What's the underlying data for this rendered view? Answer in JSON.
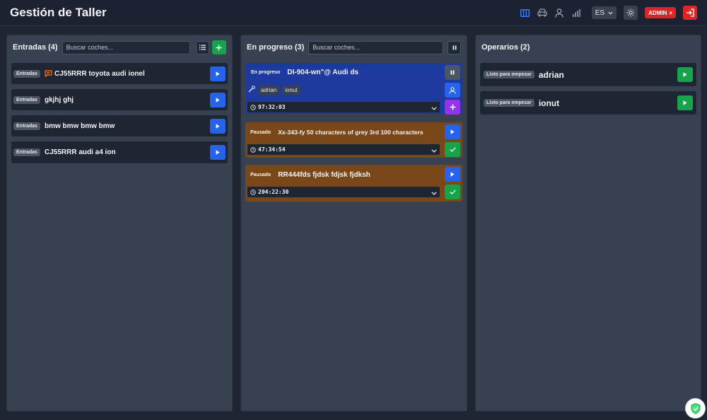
{
  "app": {
    "title": "Gestión de Taller"
  },
  "topbar": {
    "icons": [
      "board-icon",
      "car-icon",
      "user-icon",
      "bar-chart-icon"
    ],
    "language": "ES",
    "admin_label": "ADMIN",
    "admin_close": "×",
    "accent": "#2563eb",
    "danger": "#dc2626"
  },
  "entradas": {
    "title": "Entradas (4)",
    "search_placeholder": "Buscar coches...",
    "cards": [
      {
        "badge": "Entradas",
        "title": "CJ55RRR toyota audi ionel",
        "has_message": true
      },
      {
        "badge": "Entradas",
        "title": "gkjhj ghj",
        "has_message": false
      },
      {
        "badge": "Entradas",
        "title": "bmw bmw bmw bmw",
        "has_message": false
      },
      {
        "badge": "Entradas",
        "title": "CJ55RRR audi a4 ion",
        "has_message": false
      }
    ]
  },
  "progreso": {
    "title": "En progreso (3)",
    "search_placeholder": "Buscar coches...",
    "jobs": [
      {
        "status": "En progreso",
        "title": "DI-904-wn\"@ Audi ds",
        "workers": [
          "adrian",
          "ionut"
        ],
        "timer": "97:32:03",
        "color": "#1e3a9f"
      },
      {
        "status": "Pausado",
        "title": "Xx-343-fy 50 characters of grey 3rd 100 characters",
        "timer": "47:34:54",
        "color": "#7a4719"
      },
      {
        "status": "Pausado",
        "title": "RR444fds fjdsk fdjsk fjdksh",
        "timer": "204:22:30",
        "color": "#7a4719"
      }
    ]
  },
  "operarios": {
    "title": "Operarios (2)",
    "items": [
      {
        "status": "Listo para empezar",
        "name": "adrian"
      },
      {
        "status": "Listo para empezar",
        "name": "ionut"
      }
    ]
  }
}
